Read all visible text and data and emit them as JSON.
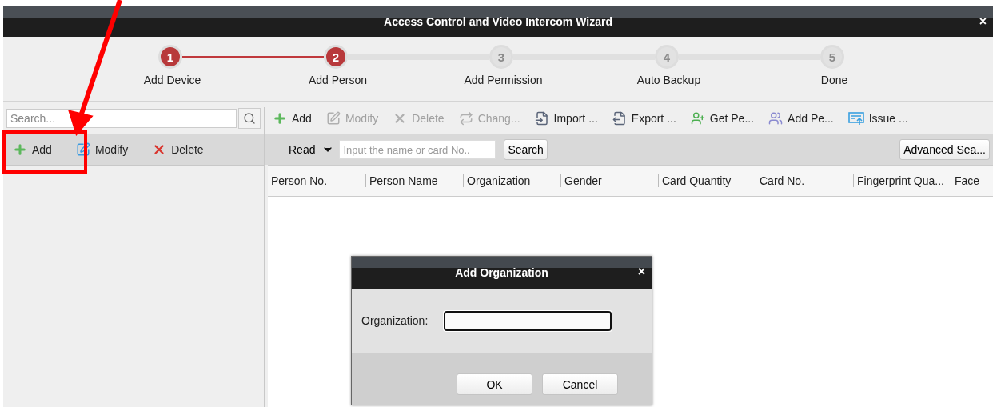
{
  "window": {
    "title": "Access Control and Video Intercom Wizard",
    "close": "×"
  },
  "steps": [
    {
      "number": "1",
      "label": "Add Device",
      "reached": true
    },
    {
      "number": "2",
      "label": "Add Person",
      "reached": true
    },
    {
      "number": "3",
      "label": "Add Permission",
      "reached": false
    },
    {
      "number": "4",
      "label": "Auto Backup",
      "reached": false
    },
    {
      "number": "5",
      "label": "Done",
      "reached": false
    }
  ],
  "sidebar": {
    "search": {
      "placeholder": "Search..."
    },
    "actions": [
      {
        "label": "Add",
        "disabled": false
      },
      {
        "label": "Modify",
        "disabled": false
      },
      {
        "label": "Delete",
        "disabled": false
      }
    ]
  },
  "toolbar": [
    {
      "label": "Add",
      "disabled": false
    },
    {
      "label": "Modify",
      "disabled": true
    },
    {
      "label": "Delete",
      "disabled": true
    },
    {
      "label": "Chang...",
      "disabled": true
    },
    {
      "label": "Import ...",
      "disabled": false
    },
    {
      "label": "Export ...",
      "disabled": false
    },
    {
      "label": "Get Pe...",
      "disabled": false
    },
    {
      "label": "Add Pe...",
      "disabled": false
    },
    {
      "label": "Issue ...",
      "disabled": false
    }
  ],
  "filter": {
    "read": "Read",
    "input": {
      "placeholder": "Input the name or card No.."
    },
    "search_button": "Search",
    "advanced_button": "Advanced Sea..."
  },
  "table": {
    "columns": [
      "Person No.",
      "Person Name",
      "Organization",
      "Gender",
      "Card Quantity",
      "Card No.",
      "Fingerprint Qua...",
      "Face"
    ]
  },
  "dialog": {
    "title": "Add Organization",
    "close": "×",
    "field_label": "Organization:",
    "buttons": [
      "OK",
      "Cancel"
    ]
  }
}
